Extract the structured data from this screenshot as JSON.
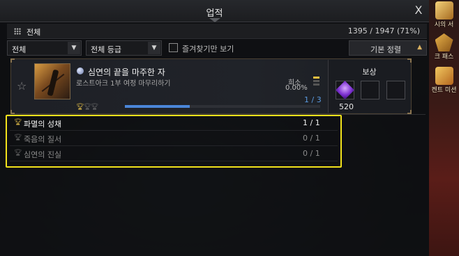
{
  "window": {
    "title": "업적",
    "close_label": "X"
  },
  "category": {
    "label": "전체",
    "progress": "1395 / 1947 (71%)"
  },
  "filters": {
    "dropdown1": "전체",
    "dropdown2": "전체 등급",
    "favorites_only_label": "즐겨찾기만 보기",
    "favorites_only_checked": false,
    "sort_label": "기본 정렬"
  },
  "achievement": {
    "title": "심연의 끝을 마주한 자",
    "subtitle": "로스트아크 1부 여정 마무리하기",
    "rarity_label": "희소",
    "rarity_pct": "0.00%",
    "rarity_level": 1,
    "progress_text": "1 / 3",
    "progress_fraction": 0.333,
    "trophies_earned": 1,
    "trophies_total": 3
  },
  "reward": {
    "title": "보상",
    "count": "520",
    "icon": "purple-gem-icon"
  },
  "sub_achievements": [
    {
      "name": "파멸의 성채",
      "count": "1 / 1",
      "done": true
    },
    {
      "name": "죽음의 질서",
      "count": "0 / 1",
      "done": false
    },
    {
      "name": "심연의 진실",
      "count": "0 / 1",
      "done": false
    }
  ],
  "side_menu": [
    {
      "label": "시의 서",
      "icon": "book-icon"
    },
    {
      "label": "크 패스",
      "icon": "pass-icon"
    },
    {
      "label": "켄트 미션",
      "icon": "gift-icon"
    }
  ],
  "colors": {
    "highlight": "#f2e21b",
    "progress": "#4a86d8",
    "gold": "#e8c24a"
  }
}
